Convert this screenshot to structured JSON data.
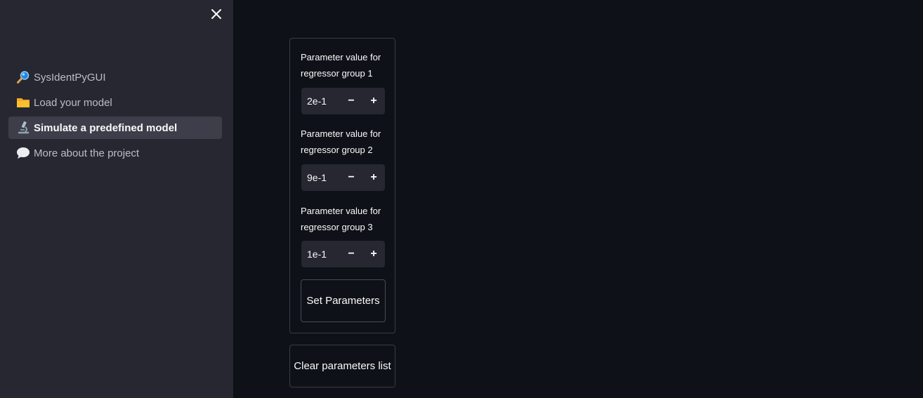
{
  "sidebar": {
    "close_icon": "close-icon",
    "items": [
      {
        "label": "SysIdentPyGUI",
        "icon": "magnifier-icon",
        "active": false
      },
      {
        "label": "Load your model",
        "icon": "folder-icon",
        "active": false
      },
      {
        "label": "Simulate a predefined model",
        "icon": "microscope-icon",
        "active": true
      },
      {
        "label": "More about the project",
        "icon": "speech-bubble-icon",
        "active": false
      }
    ]
  },
  "form": {
    "params": [
      {
        "label": "Parameter value for regressor group 1",
        "value": "2e-1"
      },
      {
        "label": "Parameter value for regressor group 2",
        "value": "9e-1"
      },
      {
        "label": "Parameter value for regressor group 3",
        "value": "1e-1"
      }
    ],
    "minus": "−",
    "plus": "+",
    "set_button": "Set Parameters"
  },
  "clear_button": "Clear parameters list",
  "colors": {
    "background": "#0e1117",
    "sidebar": "#262730",
    "active_item": "#3d3e4a",
    "text": "#fafafa"
  }
}
